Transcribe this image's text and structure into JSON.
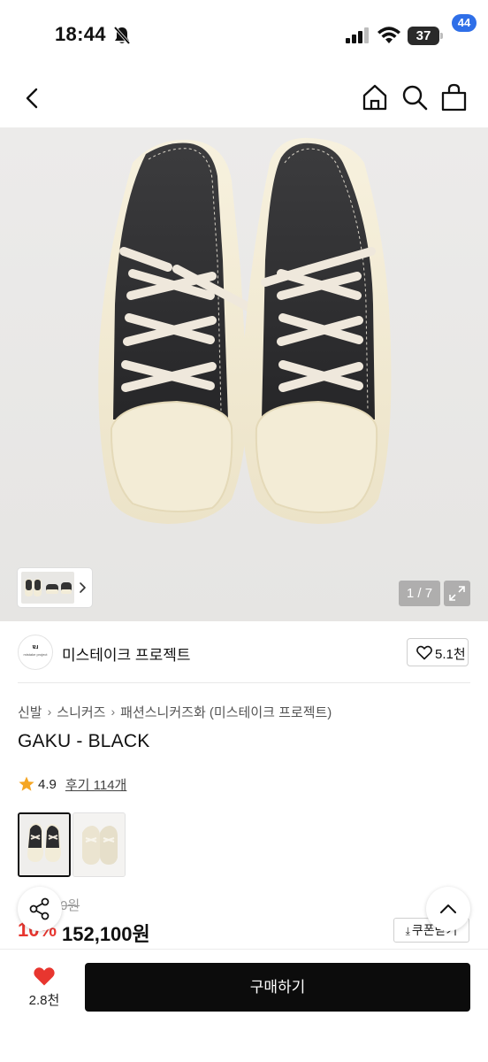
{
  "status_bar": {
    "time": "18:44",
    "battery": "37",
    "icons": [
      "bell-off-icon",
      "signal-icon",
      "wifi-icon",
      "battery-icon"
    ]
  },
  "nav": {
    "icons": [
      "back-icon",
      "home-icon",
      "search-icon",
      "cart-icon"
    ],
    "cart_badge": "44"
  },
  "gallery": {
    "pager": "1 / 7",
    "icons": [
      "chevron-right-icon",
      "expand-icon"
    ]
  },
  "brand": {
    "logo_text": "ɐɹ",
    "logo_subtext": "mistake project",
    "name": "미스테이크 프로젝트",
    "like_count": "5.1천"
  },
  "breadcrumb": [
    "신발",
    "스니커즈",
    "패션스니커즈화 (미스테이크 프로젝트)"
  ],
  "product": {
    "title": "GAKU - BLACK",
    "rating": "4.9",
    "review_link": "후기 114개",
    "options": [
      "black",
      "cream"
    ],
    "old_price": "0원",
    "discount": "10%",
    "price": "152,100원",
    "coupon_label": "쿠폰받기"
  },
  "bottom_bar": {
    "wish_count": "2.8천",
    "buy_label": "구매하기"
  },
  "colors": {
    "accent_badge": "#2f6fe8",
    "discount_red": "#e8362f",
    "star": "#f5a623",
    "heart": "#e8362f",
    "buy_button": "#0c0c0c"
  }
}
